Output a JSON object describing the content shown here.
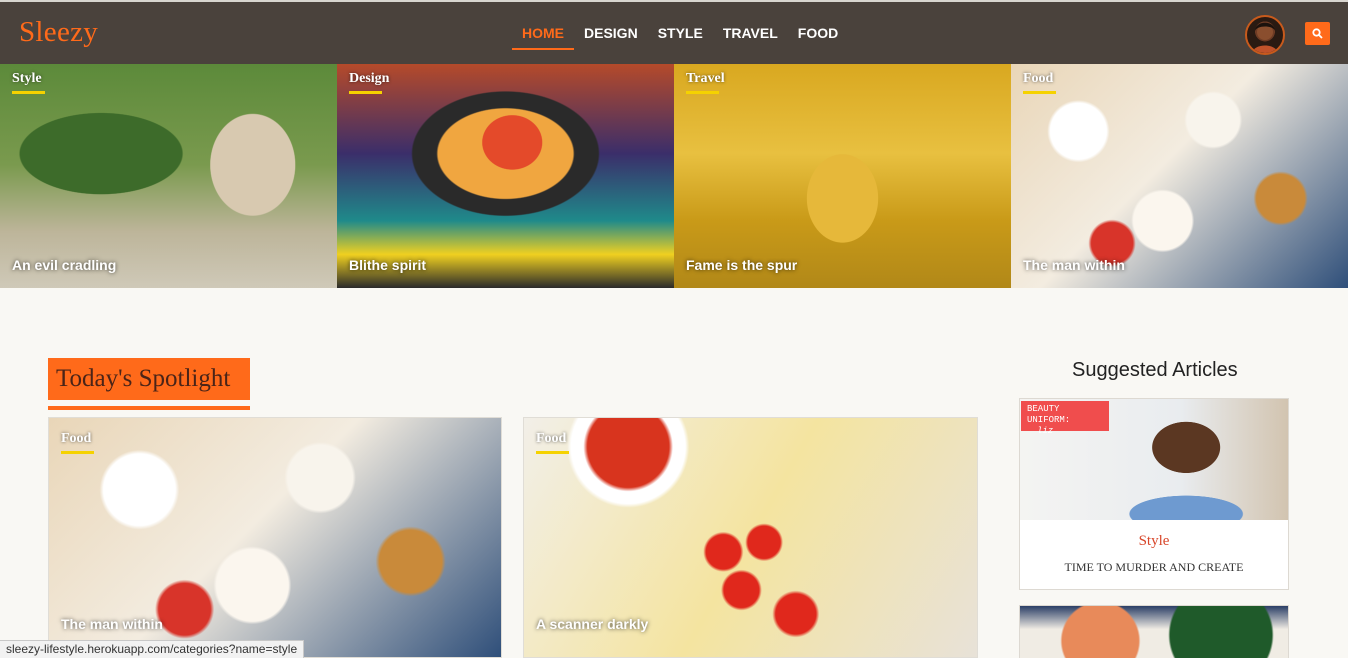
{
  "header": {
    "brand": "Sleezy",
    "nav": [
      {
        "label": "HOME",
        "active": true
      },
      {
        "label": "DESIGN",
        "active": false
      },
      {
        "label": "STYLE",
        "active": false
      },
      {
        "label": "TRAVEL",
        "active": false
      },
      {
        "label": "FOOD",
        "active": false
      }
    ],
    "accent_color": "#ff6a1a",
    "search_icon": "search-icon"
  },
  "hero": [
    {
      "category": "Style",
      "title": "An evil cradling"
    },
    {
      "category": "Design",
      "title": "Blithe spirit"
    },
    {
      "category": "Travel",
      "title": "Fame is the spur"
    },
    {
      "category": "Food",
      "title": "The man within"
    }
  ],
  "spotlight": {
    "heading": "Today's Spotlight",
    "cards": [
      {
        "category": "Food",
        "title": "The man within"
      },
      {
        "category": "Food",
        "title": "A scanner darkly"
      }
    ]
  },
  "suggested": {
    "heading": "Suggested Articles",
    "items": [
      {
        "badge": "BEAUTY UNIFORM:",
        "badge_sub": "liz",
        "category": "Style",
        "title": "TIME TO MURDER AND CREATE"
      }
    ]
  },
  "status_bar": {
    "url": "sleezy-lifestyle.herokuapp.com/categories?name=style"
  }
}
